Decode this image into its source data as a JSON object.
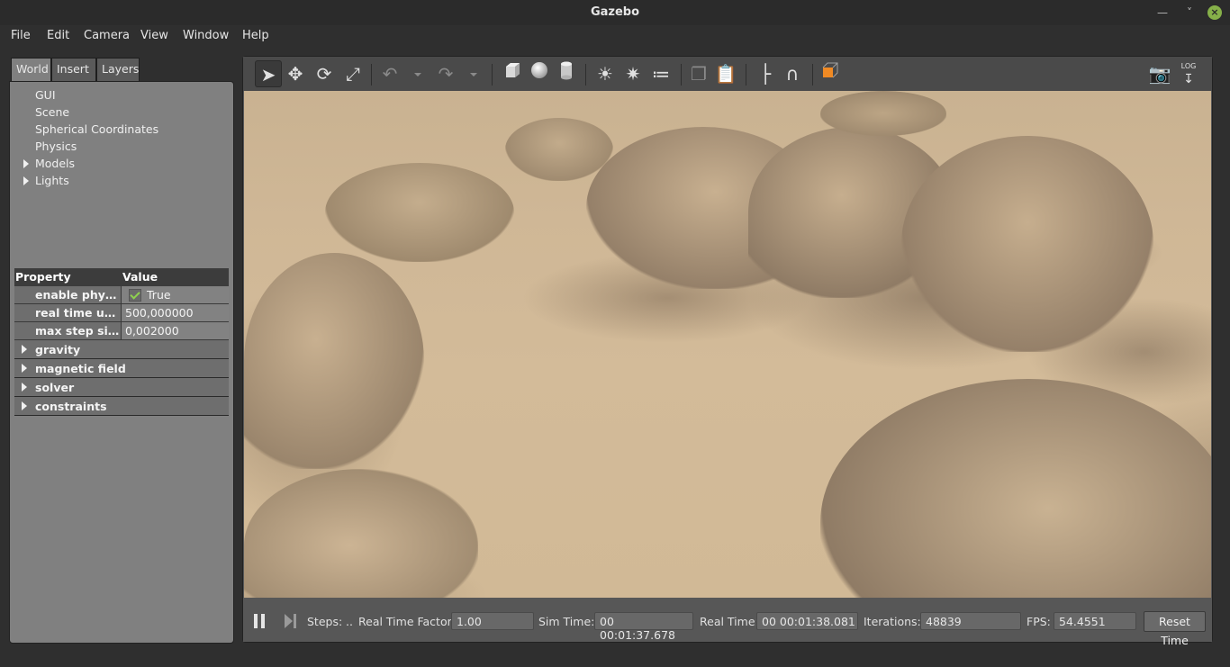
{
  "window": {
    "title": "Gazebo"
  },
  "menu": [
    "File",
    "Edit",
    "Camera",
    "View",
    "Window",
    "Help"
  ],
  "tabs": [
    "World",
    "Insert",
    "Layers"
  ],
  "tree": [
    {
      "label": "GUI",
      "expandable": false
    },
    {
      "label": "Scene",
      "expandable": false
    },
    {
      "label": "Spherical Coordinates",
      "expandable": false
    },
    {
      "label": "Physics",
      "expandable": false
    },
    {
      "label": "Models",
      "expandable": true
    },
    {
      "label": "Lights",
      "expandable": true
    }
  ],
  "properties": {
    "header": {
      "property": "Property",
      "value": "Value"
    },
    "rows": [
      {
        "name": "enable physi…",
        "value": "True",
        "checkbox": true
      },
      {
        "name": "real time up…",
        "value": "500,000000"
      },
      {
        "name": "max step size",
        "value": "0,002000"
      }
    ],
    "groups": [
      "gravity",
      "magnetic field",
      "solver",
      "constraints"
    ]
  },
  "toolbar": {
    "icons": [
      "select-arrow-icon",
      "translate-icon",
      "rotate-icon",
      "scale-icon",
      "undo-icon",
      "redo-icon",
      "box-icon",
      "sphere-icon",
      "cylinder-icon",
      "point-light-icon",
      "spot-light-icon",
      "directional-light-icon",
      "copy-icon",
      "paste-icon",
      "align-icon",
      "snap-icon",
      "view-angle-icon",
      "screenshot-icon",
      "log-icon"
    ],
    "log_label": "LOG"
  },
  "status": {
    "steps_label": "Steps:",
    "steps_value": "..",
    "rtf_label": "Real Time Factor:",
    "rtf_value": "1.00",
    "sim_time_label": "Sim Time:",
    "sim_time_value": "00 00:01:37.678",
    "real_time_label": "Real Time:",
    "real_time_value": "00 00:01:38.081",
    "iterations_label": "Iterations:",
    "iterations_value": "48839",
    "fps_label": "FPS:",
    "fps_value": "54.4551",
    "reset_label": "Reset Time"
  },
  "colors": {
    "accent": "#86b049",
    "check": "#8fd14f",
    "view_angle": "#f08a24"
  }
}
